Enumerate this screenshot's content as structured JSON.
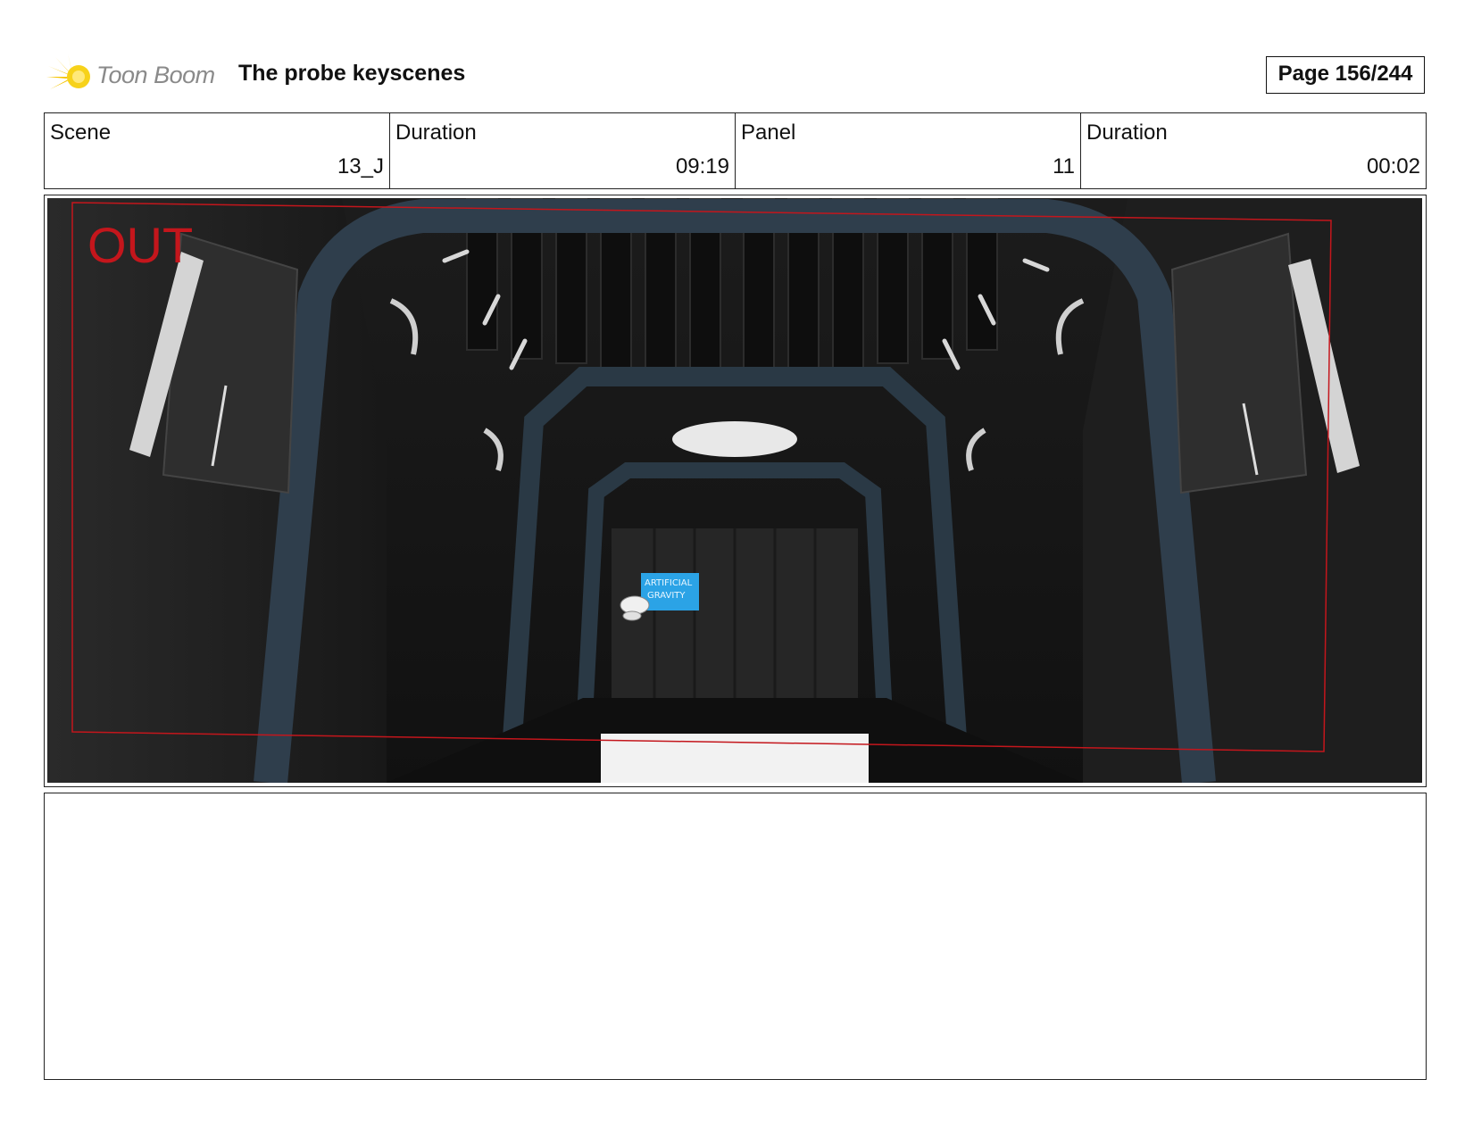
{
  "header": {
    "logo_text": "Toon Boom",
    "title": "The probe keyscenes",
    "page": "Page 156/244"
  },
  "info": [
    {
      "label": "Scene",
      "value": "13_J"
    },
    {
      "label": "Duration",
      "value": "09:19"
    },
    {
      "label": "Panel",
      "value": "11"
    },
    {
      "label": "Duration",
      "value": "00:02"
    }
  ],
  "panel": {
    "overlay_text": "OUT",
    "sign_line1": "ARTIFICIAL",
    "sign_line2": "GRAVITY"
  },
  "colors": {
    "logo_yellow": "#f5c400",
    "out_red": "#c4161c",
    "sign_blue": "#2ba3e6",
    "frame_blue": "#2f3e4c"
  },
  "notes": {
    "text": ""
  }
}
